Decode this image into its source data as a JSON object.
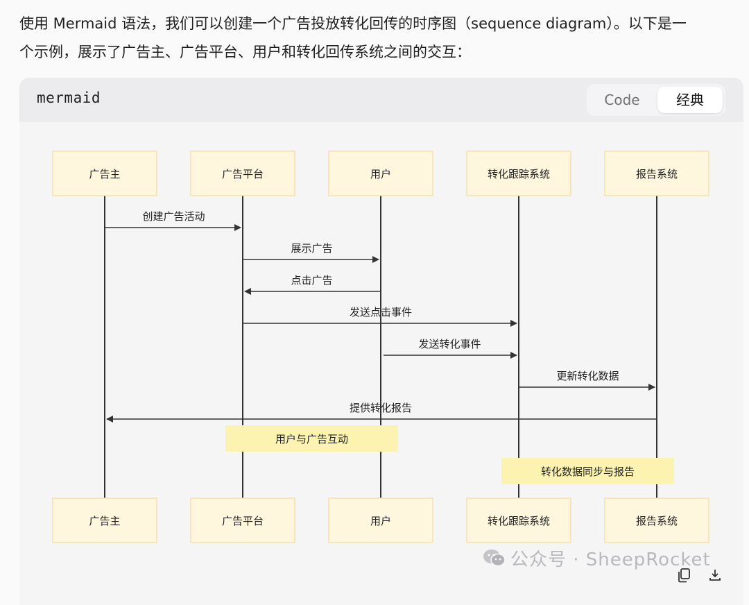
{
  "intro": {
    "line1": "使用 Mermaid 语法，我们可以创建一个广告投放转化回传的时序图（sequence diagram）。以下是一",
    "line2": "个示例，展示了广告主、广告平台、用户和转化回传系统之间的交互："
  },
  "code_block": {
    "language": "mermaid",
    "tabs": [
      {
        "label": "Code",
        "selected": false
      },
      {
        "label": "经典",
        "selected": true
      }
    ]
  },
  "diagram": {
    "participants": [
      "广告主",
      "广告平台",
      "用户",
      "转化跟踪系统",
      "报告系统"
    ],
    "messages": [
      {
        "from": 0,
        "to": 1,
        "label": "创建广告活动"
      },
      {
        "from": 1,
        "to": 2,
        "label": "展示广告"
      },
      {
        "from": 2,
        "to": 1,
        "label": "点击广告"
      },
      {
        "from": 1,
        "to": 3,
        "label": "发送点击事件"
      },
      {
        "from": 2,
        "to": 3,
        "label": "发送转化事件"
      },
      {
        "from": 3,
        "to": 4,
        "label": "更新转化数据"
      },
      {
        "from": 4,
        "to": 0,
        "label": "提供转化报告"
      }
    ],
    "notes": [
      {
        "over": [
          1,
          2
        ],
        "label": "用户与广告互动"
      },
      {
        "over": [
          3,
          4
        ],
        "label": "转化数据同步与报告"
      }
    ],
    "colors": {
      "actor_fill": "#fef6dd",
      "actor_stroke": "#f3dca0",
      "note_fill": "#fdf3b0",
      "line": "#333333"
    }
  },
  "watermark": {
    "text": "公众号 · SheepRocket",
    "icon": "wechat-icon"
  },
  "toolbar": {
    "icons": [
      "copy-icon",
      "download-icon"
    ]
  }
}
